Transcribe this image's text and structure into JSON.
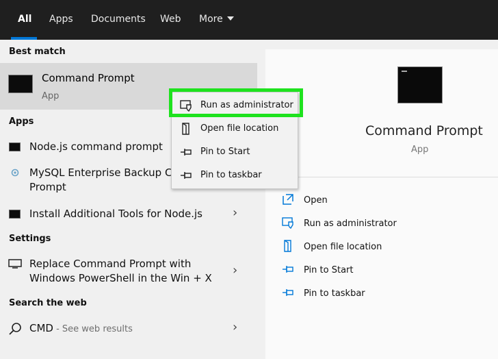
{
  "tabs": [
    {
      "label": "All",
      "active": true
    },
    {
      "label": "Apps"
    },
    {
      "label": "Documents"
    },
    {
      "label": "Web"
    },
    {
      "label": "More"
    }
  ],
  "sections": {
    "best_match": "Best match",
    "apps": "Apps",
    "settings": "Settings",
    "search_web": "Search the web"
  },
  "best_match": {
    "title": "Command Prompt",
    "subtitle": "App",
    "icon": "terminal-icon"
  },
  "apps": [
    {
      "label": "Node.js command prompt",
      "icon": "terminal-icon"
    },
    {
      "label_line1": "MySQL Enterprise Backup Co",
      "label_line2": "Prompt",
      "icon": "gear-icon"
    },
    {
      "label": "Install Additional Tools for Node.js",
      "icon": "terminal-icon"
    }
  ],
  "settings_items": [
    {
      "label_line1": "Replace Command Prompt with",
      "label_line2": "Windows PowerShell in the Win + X",
      "icon": "monitor-icon"
    }
  ],
  "web": {
    "query": "CMD",
    "suffix": " - See web results",
    "icon": "search-icon"
  },
  "context_menu": [
    {
      "label": "Run as administrator",
      "icon": "shield-icon",
      "highlighted": true
    },
    {
      "label": "Open file location",
      "icon": "folder-icon"
    },
    {
      "label": "Pin to Start",
      "icon": "pin-icon"
    },
    {
      "label": "Pin to taskbar",
      "icon": "pin-icon"
    }
  ],
  "detail": {
    "title": "Command Prompt",
    "subtitle": "App",
    "actions": [
      {
        "label": "Open",
        "icon": "open-icon"
      },
      {
        "label": "Run as administrator",
        "icon": "shield-icon"
      },
      {
        "label": "Open file location",
        "icon": "folder-icon"
      },
      {
        "label": "Pin to Start",
        "icon": "pin-icon"
      },
      {
        "label": "Pin to taskbar",
        "icon": "pin-icon"
      }
    ]
  },
  "colors": {
    "accent": "#0078d7",
    "highlight": "#1ee21e",
    "topbar": "#1f1f1f"
  }
}
